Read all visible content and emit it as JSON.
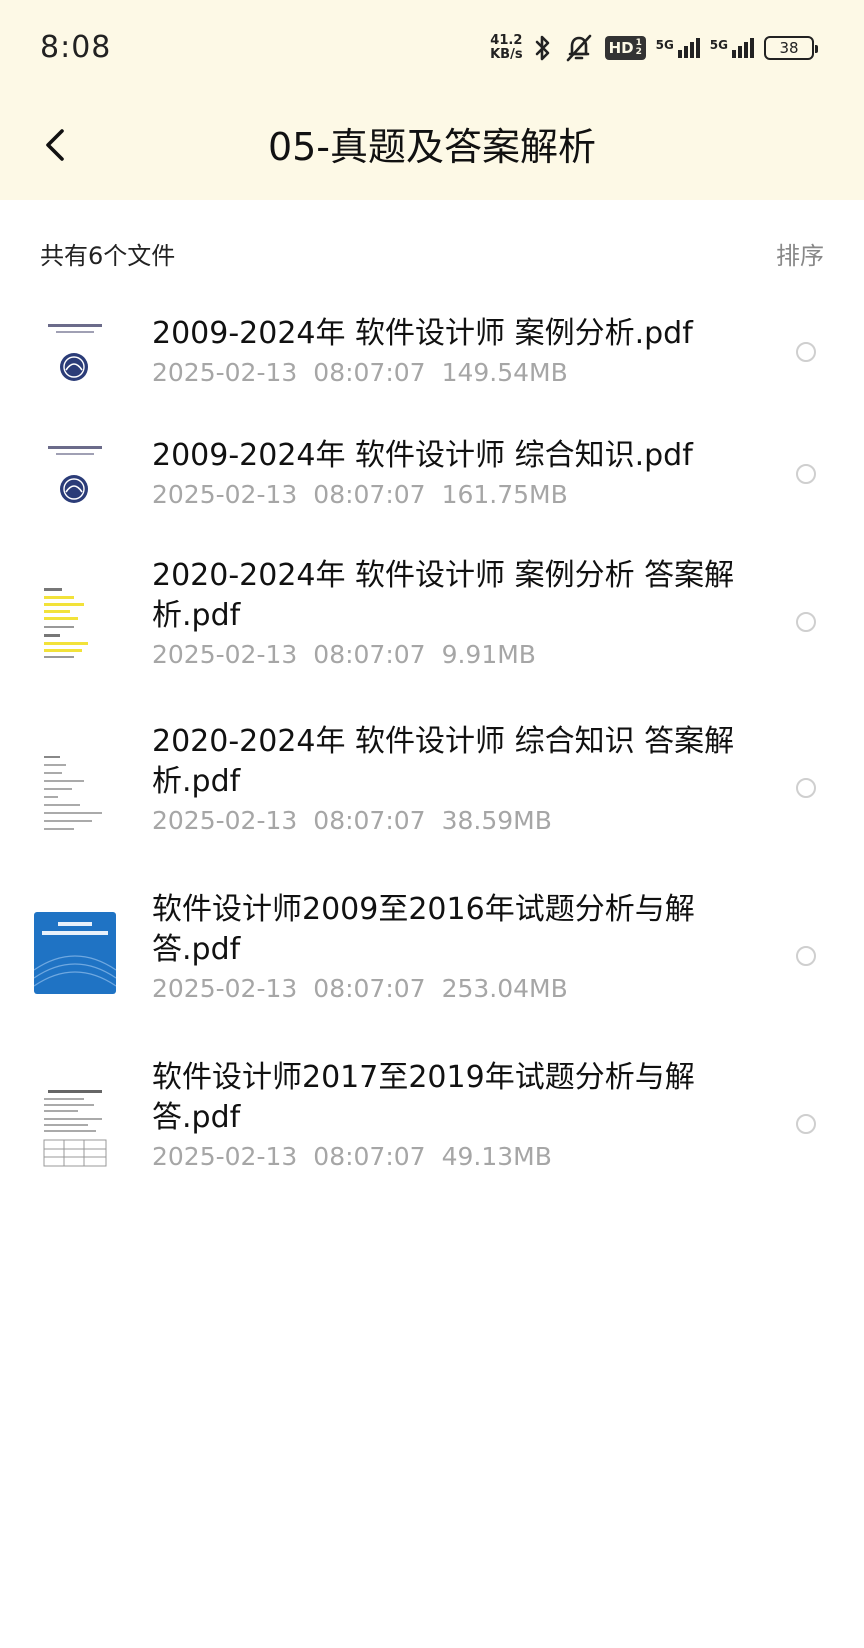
{
  "status": {
    "time": "8:08",
    "net_speed_value": "41.2",
    "net_speed_unit": "KB/s",
    "hd_label": "HD",
    "hd_sub": "1 2",
    "sim1_label": "5G",
    "sim2_label": "5G",
    "battery_level": "38"
  },
  "header": {
    "title": "05-真题及答案解析"
  },
  "list_header": {
    "summary": "共有6个文件",
    "sort_label": "排序"
  },
  "files": [
    {
      "name_line1": "2009-2024年 软件设计师 案例分析.pdf",
      "name_line2": "",
      "date": "2025-02-13",
      "time": "08:07:07",
      "size": "149.54MB",
      "thumbnail": "document-seal-cover"
    },
    {
      "name_line1": "2009-2024年 软件设计师 综合知识.pdf",
      "name_line2": "",
      "date": "2025-02-13",
      "time": "08:07:07",
      "size": "161.75MB",
      "thumbnail": "document-seal-cover"
    },
    {
      "name_line1": "2020-2024年 软件设计师 案例分析 答案解",
      "name_line2": "析.pdf",
      "date": "2025-02-13",
      "time": "08:07:07",
      "size": "9.91MB",
      "thumbnail": "highlighted-page"
    },
    {
      "name_line1": "2020-2024年 软件设计师 综合知识 答案解",
      "name_line2": "析.pdf",
      "date": "2025-02-13",
      "time": "08:07:07",
      "size": "38.59MB",
      "thumbnail": "text-page"
    },
    {
      "name_line1": "软件设计师2009至2016年试题分析与解",
      "name_line2": "答.pdf",
      "date": "2025-02-13",
      "time": "08:07:07",
      "size": "253.04MB",
      "thumbnail": "blue-book-cover"
    },
    {
      "name_line1": "软件设计师2017至2019年试题分析与解",
      "name_line2": "答.pdf",
      "date": "2025-02-13",
      "time": "08:07:07",
      "size": "49.13MB",
      "thumbnail": "table-page"
    }
  ],
  "colors": {
    "header_bg": "#fdf9e6",
    "meta_text": "#a6a6a6",
    "sort_text": "#888888",
    "radio_border": "#cfcfcf",
    "book_blue": "#1f73c4"
  }
}
